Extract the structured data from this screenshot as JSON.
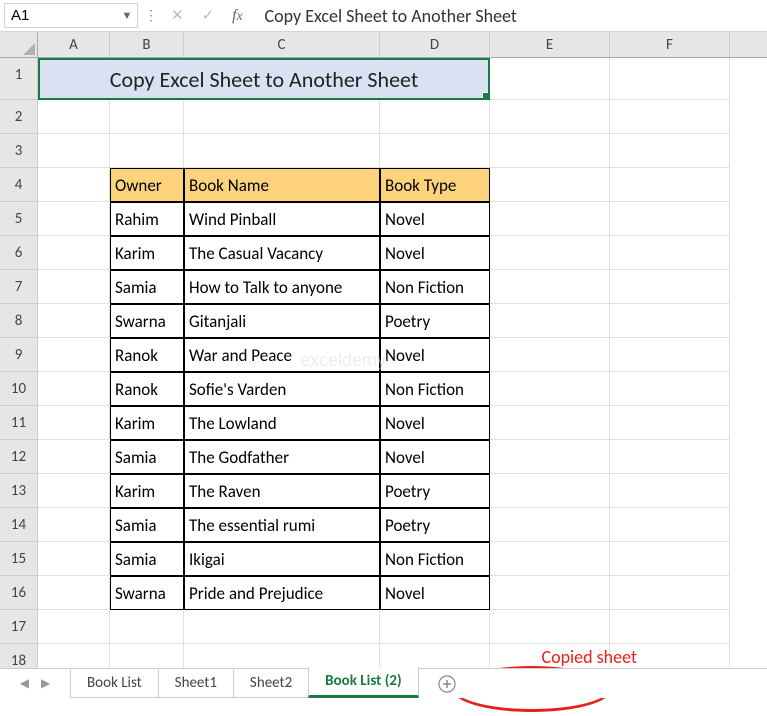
{
  "nameBox": "A1",
  "formulaBar": "Copy Excel Sheet to Another Sheet",
  "columns": [
    "A",
    "B",
    "C",
    "D",
    "E",
    "F"
  ],
  "rowCount": 18,
  "title": "Copy Excel Sheet to Another Sheet",
  "table": {
    "headers": [
      "Owner",
      "Book Name",
      "Book Type"
    ],
    "rows": [
      [
        "Rahim",
        "Wind Pinball",
        "Novel"
      ],
      [
        "Karim",
        "The Casual Vacancy",
        "Novel"
      ],
      [
        "Samia",
        "How to Talk to anyone",
        "Non Fiction"
      ],
      [
        "Swarna",
        "Gitanjali",
        "Poetry"
      ],
      [
        "Ranok",
        "War and Peace",
        "Novel"
      ],
      [
        "Ranok",
        "Sofie's Varden",
        "Non Fiction"
      ],
      [
        "Karim",
        "The Lowland",
        "Novel"
      ],
      [
        "Samia",
        "The Godfather",
        "Novel"
      ],
      [
        "Karim",
        "The Raven",
        "Poetry"
      ],
      [
        "Samia",
        "The essential rumi",
        "Poetry"
      ],
      [
        "Samia",
        "Ikigai",
        "Non Fiction"
      ],
      [
        "Swarna",
        "Pride and Prejudice",
        "Novel"
      ]
    ]
  },
  "sheetTabs": [
    {
      "label": "Book List",
      "active": false
    },
    {
      "label": "Sheet1",
      "active": false
    },
    {
      "label": "Sheet2",
      "active": false
    },
    {
      "label": "Book List (2)",
      "active": true
    }
  ],
  "annotation": "Copied sheet",
  "watermark": "exceldemy"
}
